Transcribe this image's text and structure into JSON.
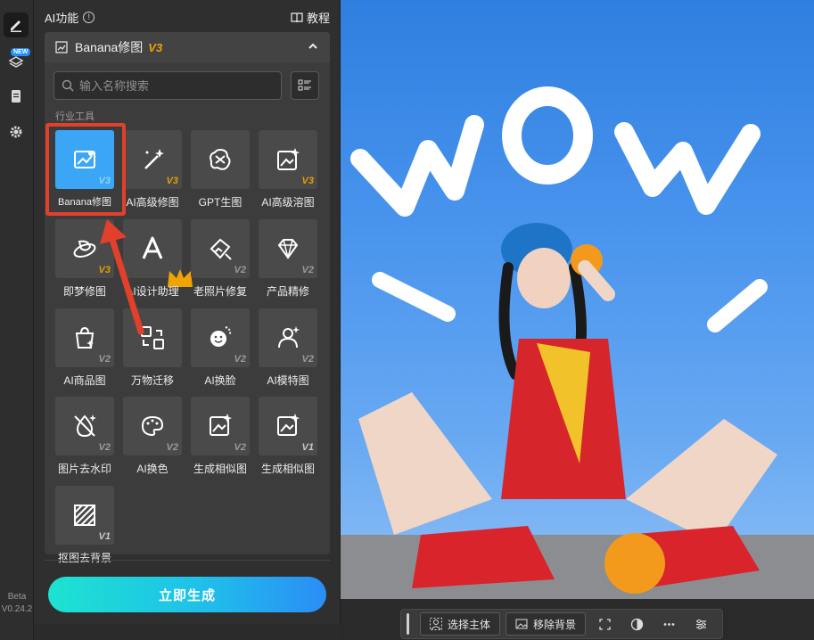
{
  "rail": {
    "new_badge": "NEW",
    "version_label": "Beta",
    "version_number": "V0.24.2"
  },
  "panel": {
    "title": "AI功能",
    "tutorial": "教程",
    "section_title": "Banana修图",
    "section_version": "V3",
    "search_placeholder": "输入名称搜索",
    "category_label": "行业工具",
    "generate_label": "立即生成"
  },
  "tools": [
    {
      "label": "Banana修图",
      "version": "V3",
      "icon": "banana-edit-icon"
    },
    {
      "label": "AI高级修图",
      "version": "V3",
      "icon": "magic-wand-icon"
    },
    {
      "label": "GPT生图",
      "version": "",
      "icon": "gpt-icon"
    },
    {
      "label": "AI高级溶图",
      "version": "V3",
      "icon": "sparkle-image-icon"
    },
    {
      "label": "即梦修图",
      "version": "V3",
      "icon": "dream-icon"
    },
    {
      "label": "AI设计助理",
      "version": "",
      "icon": "design-assistant-icon"
    },
    {
      "label": "老照片修复",
      "version": "V2",
      "icon": "photo-restore-icon"
    },
    {
      "label": "产品精修",
      "version": "V2",
      "icon": "diamond-icon"
    },
    {
      "label": "AI商品图",
      "version": "V2",
      "icon": "shopping-bag-icon"
    },
    {
      "label": "万物迁移",
      "version": "",
      "icon": "transfer-icon"
    },
    {
      "label": "AI换脸",
      "version": "V2",
      "icon": "face-swap-icon"
    },
    {
      "label": "AI模特图",
      "version": "V2",
      "icon": "model-icon"
    },
    {
      "label": "图片去水印",
      "version": "V2",
      "icon": "watermark-remove-icon"
    },
    {
      "label": "AI换色",
      "version": "V2",
      "icon": "palette-icon"
    },
    {
      "label": "生成相似图",
      "version": "V2",
      "icon": "similar-image-icon"
    },
    {
      "label": "生成相似图",
      "version": "V1",
      "icon": "similar-image-icon"
    },
    {
      "label": "抠图去背景",
      "version": "V1",
      "icon": "cutout-icon"
    }
  ],
  "canvas": {
    "photo_text": "WOW"
  },
  "bottom_bar": {
    "select_subject": "选择主体",
    "remove_background": "移除背景"
  },
  "colors": {
    "accent": "#3aa6f5",
    "highlight": "#e2402a",
    "v3": "#f0a400"
  }
}
